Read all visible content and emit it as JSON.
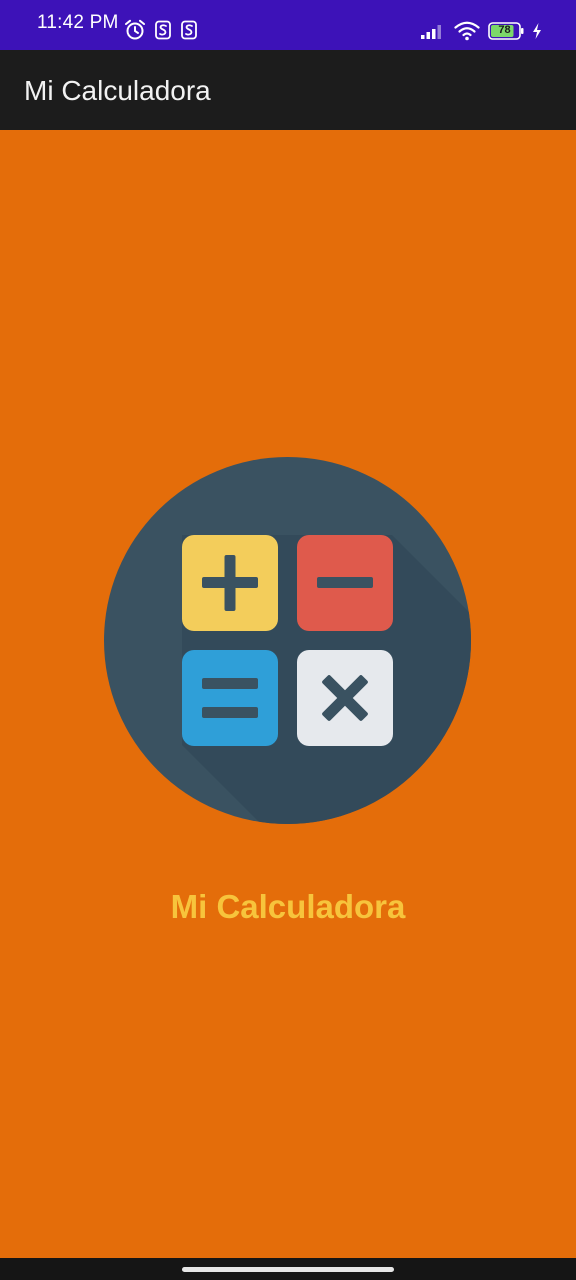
{
  "status_bar": {
    "time": "11:42 PM",
    "battery": "78",
    "background": "#3d12b8",
    "icons": [
      "alarm-icon",
      "s-notification-icon",
      "s-notification-icon",
      "signal-icon",
      "wifi-icon",
      "battery-icon",
      "charging-icon"
    ]
  },
  "app_bar": {
    "title": "Mi Calculadora",
    "background": "#1c1c1c"
  },
  "splash": {
    "logo": "calculator-logo-icon",
    "title": "Mi Calculadora",
    "background": "#e46d0a",
    "title_color": "#f7c43c"
  }
}
